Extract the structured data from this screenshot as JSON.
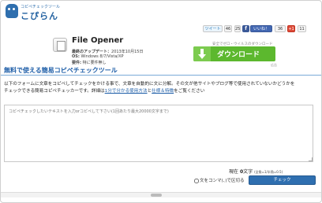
{
  "header": {
    "logo_sub": "コピペチェックツール",
    "logo_name": "こぴらん"
  },
  "social": {
    "tweet_label": "ツイート",
    "tweet_count": "46",
    "fb_count": "25",
    "like_label": "いいね！",
    "like_count": "36",
    "gplus_label": "+1",
    "gplus_count": "11"
  },
  "app": {
    "title": "File Opener",
    "update_label": "最終のアップデート：",
    "update_value": "2013年10月15日",
    "os_label": "OS:",
    "os_value": "Windows 8/7/Vista/XP",
    "req_label": "要件:",
    "req_value": "特に要件無し"
  },
  "download": {
    "caption": "安全でゼロ・ウイルスのダウンロード",
    "button_label": "ダウンロード",
    "ad_mark": "広告"
  },
  "main": {
    "section_title": "無料で使える簡易コピペチェックツール",
    "desc_line1": "以下のフォームに文章をコピペしてチェックをかける事で、文章を自動的に文に分解。その文が他サイトやブログ等で使用されていないかどうかを",
    "desc_line2_pre": "チェックできる簡易コピペチェッカーです。詳細は",
    "link1": "1分で分かる使用方法",
    "desc_link_join": "と",
    "link2": "仕様＆特徴",
    "desc_line2_post": "をご覧ください",
    "input_placeholder": "コピペチェックしたいテキストを入力orコピペして下さい(1回あたり最大20000文字まで)",
    "counter_prefix": "現在",
    "counter_value": "0",
    "counter_suffix": "文字",
    "counter_detail": "(全角=1/半角=0.5)",
    "option_label": "文をコンマ(、)で区切る",
    "check_button": "チェック"
  }
}
